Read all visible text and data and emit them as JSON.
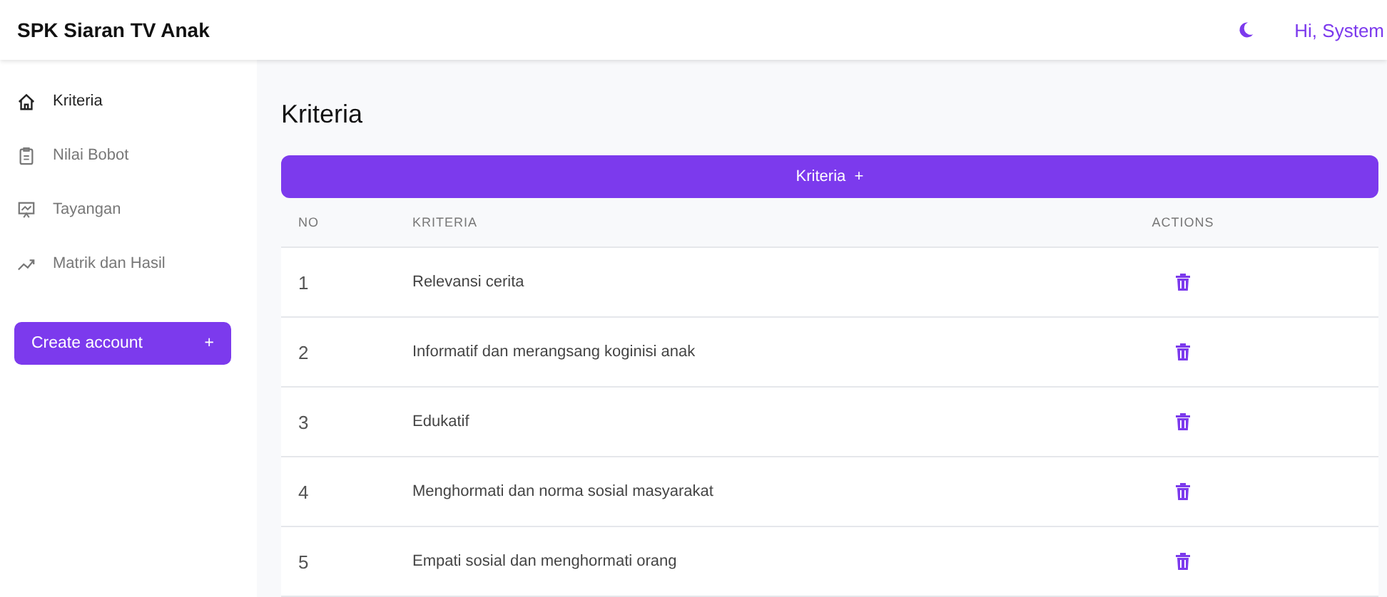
{
  "app_title": "SPK Siaran TV Anak",
  "header": {
    "greeting": "Hi, System"
  },
  "sidebar": {
    "items": [
      {
        "label": "Kriteria",
        "kind": "home",
        "selected": true
      },
      {
        "label": "Nilai Bobot",
        "kind": "clipboard",
        "selected": false
      },
      {
        "label": "Tayangan",
        "kind": "presentation",
        "selected": false
      },
      {
        "label": "Matrik dan Hasil",
        "kind": "trend",
        "selected": false
      }
    ],
    "button": {
      "label": "Create account",
      "icon": "+"
    }
  },
  "page_title": "Kriteria",
  "add_button": {
    "label": "Kriteria",
    "icon": "+"
  },
  "table": {
    "columns": [
      "NO",
      "KRITERIA",
      "ACTIONS"
    ],
    "rows": [
      {
        "no": "1",
        "kriteria": "Relevansi cerita"
      },
      {
        "no": "2",
        "kriteria": "Informatif dan merangsang koginisi anak"
      },
      {
        "no": "3",
        "kriteria": "Edukatif"
      },
      {
        "no": "4",
        "kriteria": "Menghormati dan norma sosial masyarakat"
      },
      {
        "no": "5",
        "kriteria": "Empati sosial dan menghormati orang"
      }
    ]
  }
}
